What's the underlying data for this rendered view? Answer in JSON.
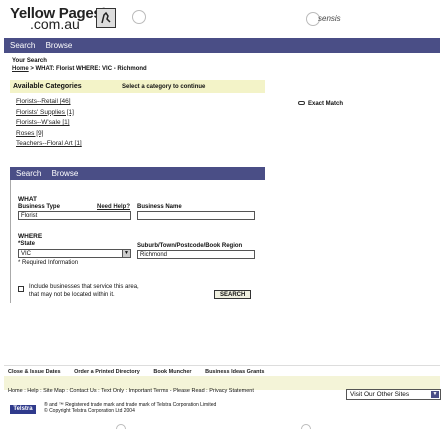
{
  "logo": {
    "name": "Yellow Pages",
    "reg": "®",
    "domain": ".com.au"
  },
  "sensis": "sensis",
  "nav": {
    "search": "Search",
    "browse": "Browse"
  },
  "your_search": {
    "label": "Your Search",
    "home": "Home",
    "path": " > WHAT: Florist WHERE: VIC - Richmond"
  },
  "categories": {
    "title": "Available Categories",
    "hint": "Select a category to continue",
    "items": [
      "Florists--Retail [46]",
      "Florists' Supplies [1]",
      "Florists--W'sale [1]",
      "Roses [9]",
      "Teachers--Floral Art [1]"
    ],
    "exact_match": "Exact Match"
  },
  "search_panel": {
    "tab_search": "Search",
    "tab_browse": "Browse",
    "what_heading": "WHAT",
    "business_type_label": "Business Type",
    "need_help": "Need Help?",
    "business_name_label": "Business Name",
    "business_type_value": "Florist",
    "business_name_value": "",
    "where_heading": "WHERE",
    "state_label": "*State",
    "state_value": "VIC",
    "suburb_label": "Suburb/Town/Postcode/Book Region",
    "suburb_value": "Richmond",
    "required_note": "* Required Information",
    "include_line1": "Include businesses that service this area,",
    "include_line2": "that may not be located within it.",
    "search_button": "SEARCH"
  },
  "bottom_menu": [
    "Close & Issue Dates",
    "Order a Printed Directory",
    "Book Muncher",
    "Business Ideas Grants"
  ],
  "footer": {
    "links": "Home : Help : Site Map : Contact Us : Text Only : Important Terms - Please Read : Privacy Statement",
    "other_sites": "Visit Our Other Sites",
    "telstra": "Telstra",
    "copyright1": "® and ™ Registered trade mark and trade mark of Telstra Corporation Limited",
    "copyright2": "© Copyright Telstra Corporation Ltd 2004"
  }
}
